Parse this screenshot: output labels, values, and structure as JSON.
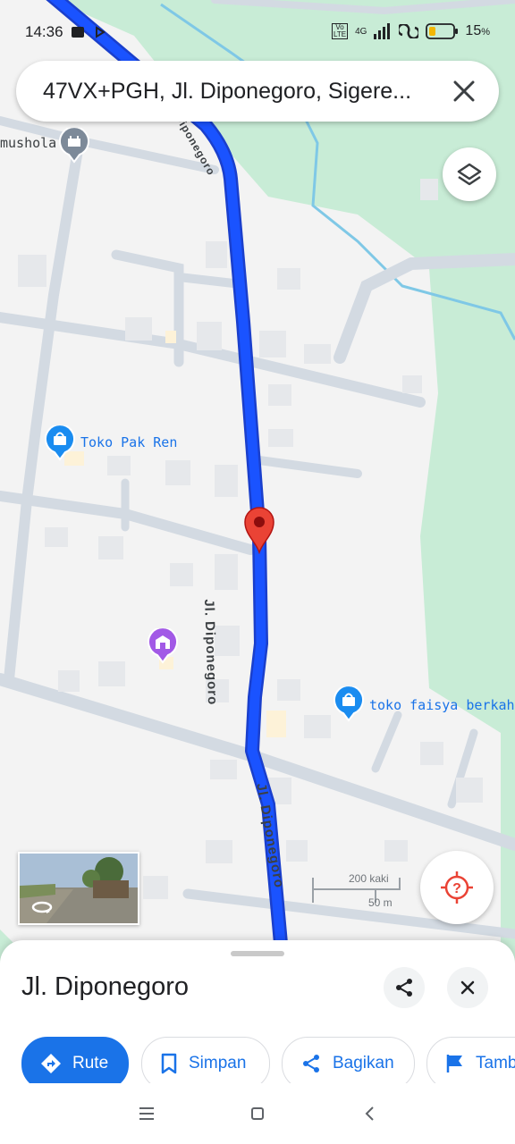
{
  "status_bar": {
    "time": "14:36",
    "battery": "15",
    "battery_unit": "%",
    "network": "4G",
    "volte": "Vo LTE"
  },
  "search": {
    "text": "47VX+PGH, Jl. Diponegoro, Sigere..."
  },
  "map": {
    "places": [
      {
        "name": "mushola",
        "icon": "mosque-icon"
      },
      {
        "name": "Toko Pak Ren",
        "icon": "shopping-bag-icon"
      },
      {
        "name": "toko faisya berkah",
        "icon": "shopping-bag-icon"
      },
      {
        "name": "",
        "icon": "store-icon"
      }
    ],
    "road_label_1": "Jl. Diponegoro",
    "road_label_2": "Jl. Diponegoro",
    "road_label_3": "Diponegoro",
    "scale_feet": "200 kaki",
    "scale_meters": "50 m",
    "colors": {
      "route": "#1a53ff",
      "park": "#c8ecd6",
      "pin": "#ea4335",
      "water": "#7fc8e6"
    }
  },
  "sheet": {
    "title": "Jl. Diponegoro",
    "actions": [
      {
        "label": "Rute",
        "icon": "directions-icon"
      },
      {
        "label": "Simpan",
        "icon": "bookmark-icon"
      },
      {
        "label": "Bagikan",
        "icon": "share-icon"
      },
      {
        "label": "Tamb",
        "icon": "flag-icon"
      }
    ]
  }
}
